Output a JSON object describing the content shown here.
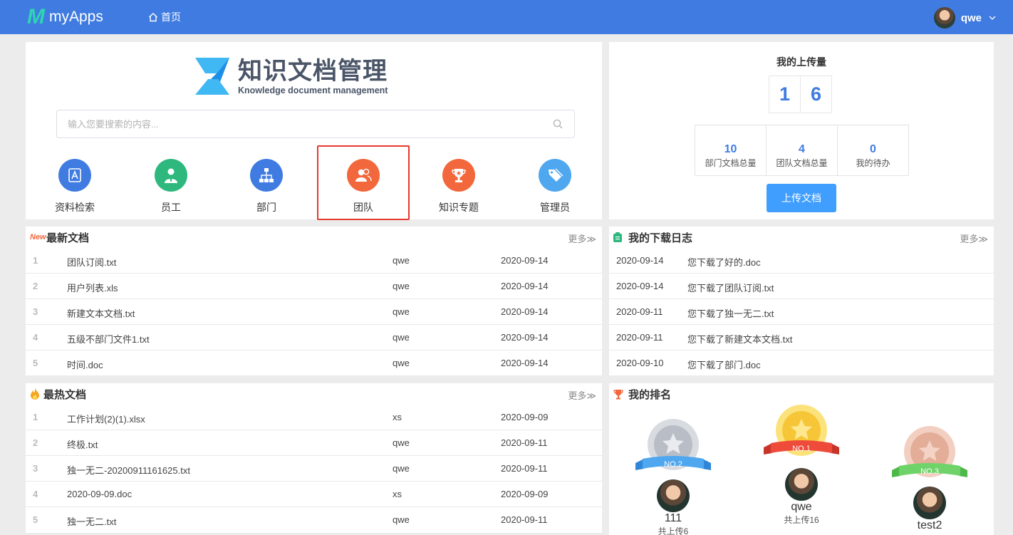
{
  "topbar": {
    "app_name": "myApps",
    "home_label": "首页",
    "user_name": "qwe"
  },
  "search_panel": {
    "brand_title": "知识文档管理",
    "brand_subtitle": "Knowledge document management",
    "search_placeholder": "输入您要搜索的内容...",
    "quick_links": [
      {
        "label": "资料检索",
        "icon": "search-doc-icon",
        "color": "#3f7be0"
      },
      {
        "label": "员工",
        "icon": "employee-icon",
        "color": "#2eb87e"
      },
      {
        "label": "部门",
        "icon": "org-chart-icon",
        "color": "#3f7be0"
      },
      {
        "label": "团队",
        "icon": "team-icon",
        "color": "#f2673b",
        "selected": true
      },
      {
        "label": "知识专题",
        "icon": "trophy-icon",
        "color": "#f2673b"
      },
      {
        "label": "管理员",
        "icon": "tag-icon",
        "color": "#4ea7ef"
      }
    ]
  },
  "upload": {
    "title": "我的上传量",
    "digits": [
      "1",
      "6"
    ],
    "stats": [
      {
        "value": "10",
        "label": "部门文档总量"
      },
      {
        "value": "4",
        "label": "团队文档总量"
      },
      {
        "value": "0",
        "label": "我的待办"
      }
    ],
    "button_label": "上传文档"
  },
  "latest_docs": {
    "badge": "New",
    "title": "最新文档",
    "more": "更多≫",
    "rows": [
      {
        "idx": "1",
        "name": "团队订阅.txt",
        "user": "qwe",
        "date": "2020-09-14"
      },
      {
        "idx": "2",
        "name": "用户列表.xls",
        "user": "qwe",
        "date": "2020-09-14"
      },
      {
        "idx": "3",
        "name": "新建文本文档.txt",
        "user": "qwe",
        "date": "2020-09-14"
      },
      {
        "idx": "4",
        "name": "五级不部门文件1.txt",
        "user": "qwe",
        "date": "2020-09-14"
      },
      {
        "idx": "5",
        "name": "时间.doc",
        "user": "qwe",
        "date": "2020-09-14"
      }
    ]
  },
  "download_log": {
    "title": "我的下载日志",
    "more": "更多≫",
    "rows": [
      {
        "date": "2020-09-14",
        "msg": "您下载了好的.doc"
      },
      {
        "date": "2020-09-14",
        "msg": "您下载了团队订阅.txt"
      },
      {
        "date": "2020-09-11",
        "msg": "您下载了独一无二.txt"
      },
      {
        "date": "2020-09-11",
        "msg": "您下载了新建文本文档.txt"
      },
      {
        "date": "2020-09-10",
        "msg": "您下载了部门.doc"
      }
    ]
  },
  "hot_docs": {
    "title": "最热文档",
    "more": "更多≫",
    "rows": [
      {
        "idx": "1",
        "name": "工作计划(2)(1).xlsx",
        "user": "xs",
        "date": "2020-09-09"
      },
      {
        "idx": "2",
        "name": "终极.txt",
        "user": "qwe",
        "date": "2020-09-11"
      },
      {
        "idx": "3",
        "name": "独一无二-20200911161625.txt",
        "user": "qwe",
        "date": "2020-09-11"
      },
      {
        "idx": "4",
        "name": "2020-09-09.doc",
        "user": "xs",
        "date": "2020-09-09"
      },
      {
        "idx": "5",
        "name": "独一无二.txt",
        "user": "qwe",
        "date": "2020-09-11"
      }
    ]
  },
  "ranking": {
    "title": "我的排名",
    "items": [
      {
        "badge": "NO.2",
        "name": "111",
        "sub": "共上传6",
        "medal_color": "#c9cdd3",
        "ribbon_color": "#4ea7ef"
      },
      {
        "badge": "NO.1",
        "name": "qwe",
        "sub": "共上传16",
        "medal_color": "#f8c740",
        "ribbon_color": "#ee4b3b"
      },
      {
        "badge": "NO.3",
        "name": "test2",
        "sub": "",
        "medal_color": "#e3ad98",
        "ribbon_color": "#6fd36a"
      }
    ]
  }
}
